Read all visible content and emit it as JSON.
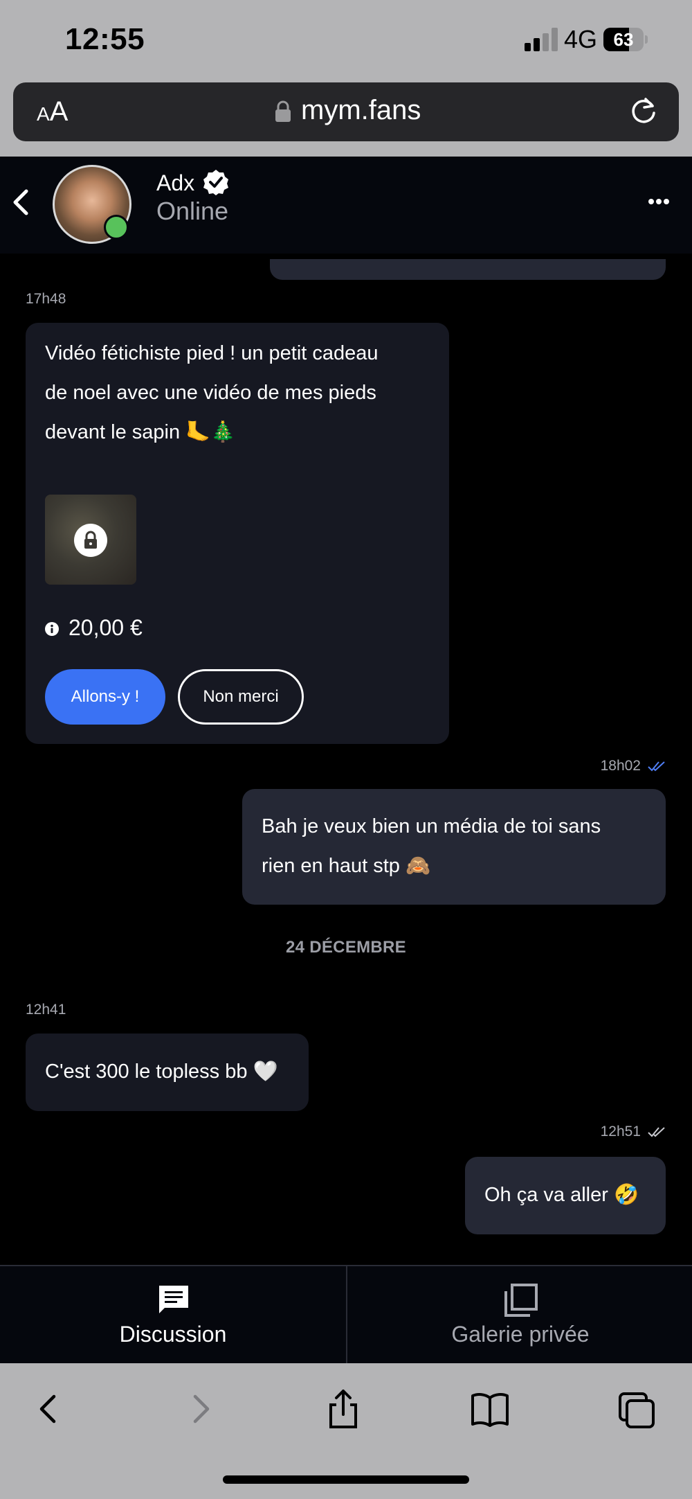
{
  "status_bar": {
    "time": "12:55",
    "network": "4G",
    "battery": "63",
    "battery_level": 0.63
  },
  "browser": {
    "text_size_label_small": "A",
    "text_size_label_large": "A",
    "url": "mym.fans",
    "icons": [
      "lock-icon",
      "reload-icon"
    ]
  },
  "chat_header": {
    "name": "Adx",
    "status": "Online",
    "icons": [
      "back-icon",
      "verified-icon",
      "more-icon"
    ]
  },
  "messages": [
    {
      "direction": "incoming",
      "time": "17h48",
      "text_lines": [
        "Vidéo fétichiste pied ! un petit cadeau",
        "de noel avec une vidéo de mes pieds",
        "devant le sapin 🦶🎄"
      ],
      "locked_media": true,
      "price": "20,00 €",
      "accept_label": "Allons-y !",
      "decline_label": "Non merci"
    },
    {
      "direction": "outgoing",
      "time": "18h02",
      "read": true,
      "text_lines": [
        "Bah je veux bien un média de toi sans",
        "rien en haut stp 🙈"
      ]
    },
    {
      "type": "date_separator",
      "label": "24 DÉCEMBRE"
    },
    {
      "direction": "incoming",
      "time": "12h41",
      "text_lines": [
        "C'est 300 le topless bb 🤍"
      ]
    },
    {
      "direction": "outgoing",
      "time": "12h51",
      "read": false,
      "text_lines": [
        "Oh ça va aller 🤣"
      ]
    }
  ],
  "tabs": [
    {
      "label": "Discussion",
      "active": true,
      "icon": "chat-icon"
    },
    {
      "label": "Galerie privée",
      "active": false,
      "icon": "gallery-icon"
    }
  ],
  "toolbar": {
    "icons": [
      "back-icon",
      "forward-icon",
      "share-icon",
      "bookmarks-icon",
      "tabs-icon"
    ]
  },
  "colors": {
    "accent_blue": "#3a72f4",
    "online_green": "#58c25b",
    "incoming_bubble": "#161822",
    "outgoing_bubble": "#252835",
    "read_check": "#4f7ef5"
  }
}
